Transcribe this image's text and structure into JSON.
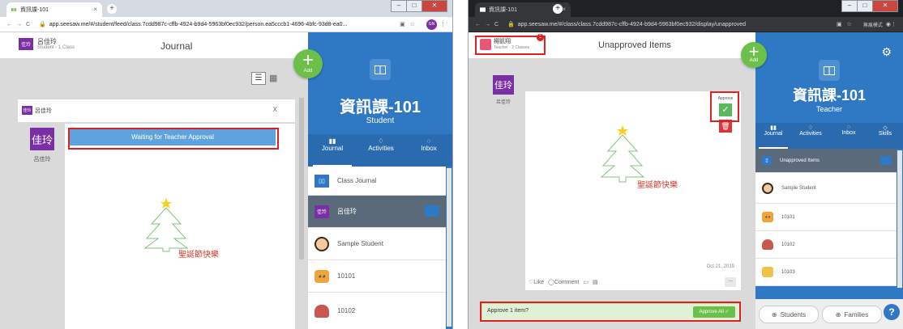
{
  "left": {
    "tab_title": "資訊課-101",
    "url": "app.seesaw.me/#/student/feed/class.7cdd987c-cffb-4924-b9d4-5963bf0ec932/person.ea5cccb1-4696-4bfc-93d8-ea0...",
    "profile_badge": "GN",
    "user": {
      "avatar": "佳玲",
      "name": "呂佳玲",
      "role": "Student - 1 Class"
    },
    "page_title": "Journal",
    "add_label": "Add",
    "post": {
      "author_avatar": "佳玲",
      "author_name": "呂佳玲",
      "close": "X",
      "big_avatar": "佳玲",
      "big_name": "呂佳玲",
      "status": "Waiting for Teacher Approval",
      "drawing_text": "聖誕節快樂"
    },
    "class": {
      "name": "資訊課-101",
      "role": "Student"
    },
    "tabs": [
      {
        "label": "Journal"
      },
      {
        "label": "Activities"
      },
      {
        "label": "Inbox"
      }
    ],
    "list": [
      {
        "label": "Class Journal",
        "icon": "journal-icon"
      },
      {
        "label": "呂佳玲",
        "avatar": "佳玲"
      },
      {
        "label": "Sample Student",
        "icon": "student-face-icon"
      },
      {
        "label": "10101",
        "icon": "tiger-icon"
      },
      {
        "label": "10102",
        "icon": "octopus-icon"
      }
    ]
  },
  "right": {
    "tab_title": "資訊課-101",
    "url": "app.seesaw.me/#/class/class.7cdd987c-cffb-4924-b9d4-5963bf0ec932/display/unapproved",
    "profile_label": "無痕模式",
    "user": {
      "name": "楊凱翔",
      "role": "Teacher - 2 Classes",
      "notif": "1"
    },
    "page_title": "Unapproved Items",
    "add_label": "Add",
    "post": {
      "author_avatar": "佳玲",
      "author_name": "呂佳玲",
      "approve_label": "Approve",
      "drawing_text": "聖誕節快樂",
      "date": "Oct 21, 2019",
      "like": "Like",
      "comment": "Comment",
      "more": "..."
    },
    "approve_bar": {
      "text": "Approve 1 item?",
      "button": "Approve All"
    },
    "class": {
      "name": "資訊課-101",
      "role": "Teacher"
    },
    "tabs": [
      {
        "label": "Journal"
      },
      {
        "label": "Activities"
      },
      {
        "label": "Inbox"
      },
      {
        "label": "Skills"
      }
    ],
    "list": [
      {
        "label": "Unapproved Items",
        "icon": "unapproved-icon"
      },
      {
        "label": "Sample Student",
        "icon": "student-face-icon"
      },
      {
        "label": "10101",
        "icon": "tiger-icon"
      },
      {
        "label": "10102",
        "icon": "octopus-icon"
      },
      {
        "label": "10103",
        "icon": "cat-icon"
      }
    ],
    "students_btn": "Students",
    "families_btn": "Families",
    "help": "?"
  },
  "colors": {
    "brand_blue": "#2f78c4",
    "add_green": "#6cc04a",
    "highlight_red": "#e02020",
    "avatar_purple": "#7b2fa5",
    "status_blue": "#5fa3dc"
  }
}
